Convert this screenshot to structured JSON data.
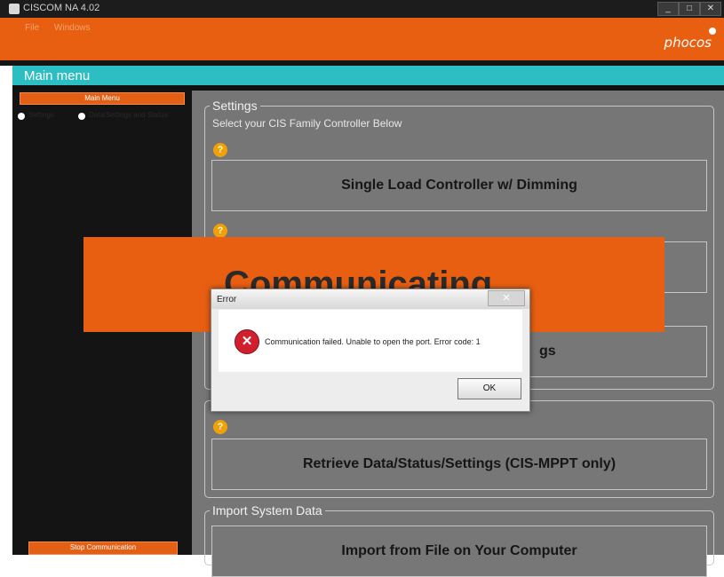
{
  "window": {
    "title": "CISCOM NA 4.02",
    "controls": [
      "_",
      "□",
      "✕"
    ]
  },
  "menu": [
    "File",
    "Windows"
  ],
  "brand": {
    "logo_text": "phocos"
  },
  "main_menu_title": "Main menu",
  "left_panel": {
    "main_menu_button": "Main Menu",
    "radios": [
      "Settings",
      "Data/Settings and Status"
    ],
    "stop_button": "Stop Communication"
  },
  "settings": {
    "legend": "Settings",
    "subtitle": "Select your CIS Family Controller Below",
    "buttons": [
      "Single Load Controller w/ Dimming",
      "",
      "gs"
    ]
  },
  "retrieve": {
    "button": "Retrieve Data/Status/Settings (CIS-MPPT only)"
  },
  "import": {
    "legend": "Import System Data",
    "button": "Import from File on Your Computer"
  },
  "help_icon": "?",
  "overlay": {
    "text": "Communicating"
  },
  "dialog": {
    "title": "Error",
    "close": "✕",
    "message": "Communication failed. Unable to open the port. Error code: 1",
    "ok": "OK"
  }
}
